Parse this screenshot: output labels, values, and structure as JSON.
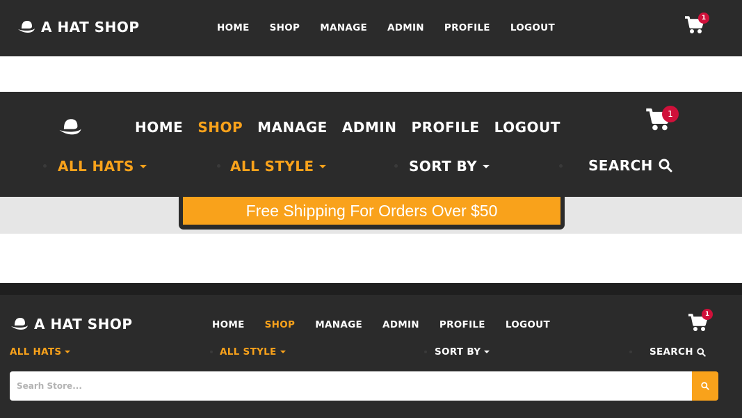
{
  "brand": {
    "name": "A HAT SHOP"
  },
  "nav": {
    "items": [
      "HOME",
      "SHOP",
      "MANAGE",
      "ADMIN",
      "PROFILE",
      "LOGOUT"
    ],
    "active_color": "#f9a21b"
  },
  "cart": {
    "count": "1"
  },
  "filters": {
    "all_hats": "ALL HATS",
    "all_style": "ALL STYLE",
    "sort_by": "SORT BY",
    "search": "SEARCH"
  },
  "promo": {
    "text": "Free Shipping For Orders Over $50"
  },
  "search": {
    "placeholder": "Searh Store..."
  },
  "colors": {
    "navbar_bg": "#2b2b2b",
    "accent": "#f9a21b",
    "badge": "#d0103a",
    "strip_bg": "#e6e6e6"
  }
}
